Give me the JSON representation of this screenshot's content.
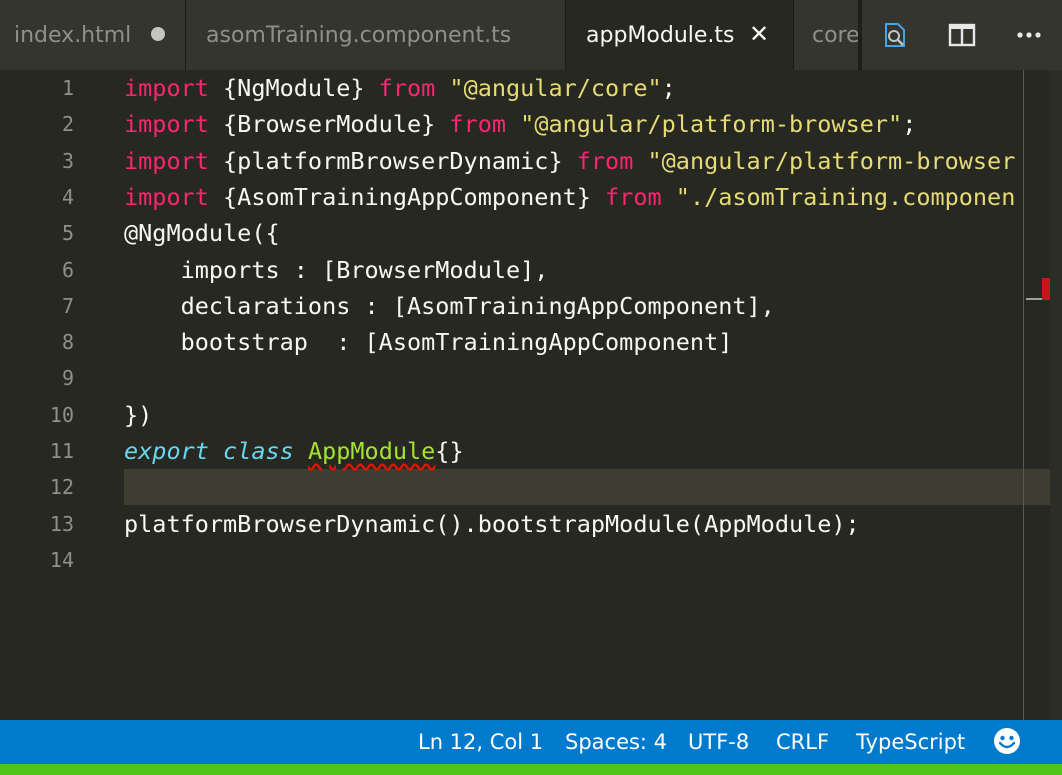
{
  "tabs": [
    {
      "label": "index.html",
      "state": "modified"
    },
    {
      "label": "asomTraining.component.ts",
      "state": "inactive"
    },
    {
      "label": "appModule.ts",
      "state": "active"
    },
    {
      "label": "core",
      "state": "inactive"
    }
  ],
  "tab_actions": [
    "open-changes-icon",
    "split-editor-icon",
    "more-actions-icon"
  ],
  "close_glyph": "✕",
  "editor": {
    "current_line": 12,
    "lines": [
      {
        "n": "1",
        "tokens": [
          {
            "t": "import",
            "c": "kw"
          },
          {
            "t": " {NgModule} "
          },
          {
            "t": "from",
            "c": "kw"
          },
          {
            "t": " "
          },
          {
            "t": "\"@angular/core\"",
            "c": "str"
          },
          {
            "t": ";"
          }
        ]
      },
      {
        "n": "2",
        "tokens": [
          {
            "t": "import",
            "c": "kw"
          },
          {
            "t": " {BrowserModule} "
          },
          {
            "t": "from",
            "c": "kw"
          },
          {
            "t": " "
          },
          {
            "t": "\"@angular/platform-browser\"",
            "c": "str"
          },
          {
            "t": ";"
          }
        ]
      },
      {
        "n": "3",
        "tokens": [
          {
            "t": "import",
            "c": "kw"
          },
          {
            "t": " {platformBrowserDynamic} "
          },
          {
            "t": "from",
            "c": "kw"
          },
          {
            "t": " "
          },
          {
            "t": "\"@angular/platform-browser",
            "c": "str"
          }
        ]
      },
      {
        "n": "4",
        "tokens": [
          {
            "t": "import",
            "c": "kw"
          },
          {
            "t": " {AsomTrainingAppComponent} "
          },
          {
            "t": "from",
            "c": "kw"
          },
          {
            "t": " "
          },
          {
            "t": "\"./asomTraining.componen",
            "c": "str"
          }
        ]
      },
      {
        "n": "5",
        "tokens": [
          {
            "t": "@NgModule({"
          }
        ]
      },
      {
        "n": "6",
        "tokens": [
          {
            "t": "    imports : [BrowserModule],"
          }
        ]
      },
      {
        "n": "7",
        "tokens": [
          {
            "t": "    declarations : [AsomTrainingAppComponent],"
          }
        ]
      },
      {
        "n": "8",
        "tokens": [
          {
            "t": "    bootstrap  : [AsomTrainingAppComponent]"
          }
        ]
      },
      {
        "n": "9",
        "tokens": []
      },
      {
        "n": "10",
        "tokens": [
          {
            "t": "})"
          }
        ]
      },
      {
        "n": "11",
        "tokens": [
          {
            "t": "export",
            "c": "it"
          },
          {
            "t": " "
          },
          {
            "t": "class",
            "c": "it"
          },
          {
            "t": " "
          },
          {
            "t": "AppModule",
            "c": "cls"
          },
          {
            "t": "{}"
          }
        ]
      },
      {
        "n": "12",
        "tokens": []
      },
      {
        "n": "13",
        "tokens": [
          {
            "t": "platformBrowserDynamic().bootstrapModule(AppModule);"
          }
        ]
      },
      {
        "n": "14",
        "tokens": []
      }
    ]
  },
  "status": {
    "position": "Ln 12, Col 1",
    "spaces": "Spaces: 4",
    "encoding": "UTF-8",
    "eol": "CRLF",
    "language": "TypeScript",
    "feedback_icon": "smiley-feedback-icon"
  },
  "colors": {
    "background": "#272822",
    "keyword": "#f92672",
    "string": "#e6db74",
    "storage": "#66d9ef",
    "class_name": "#a6e22e",
    "status_bar": "#007acc"
  }
}
